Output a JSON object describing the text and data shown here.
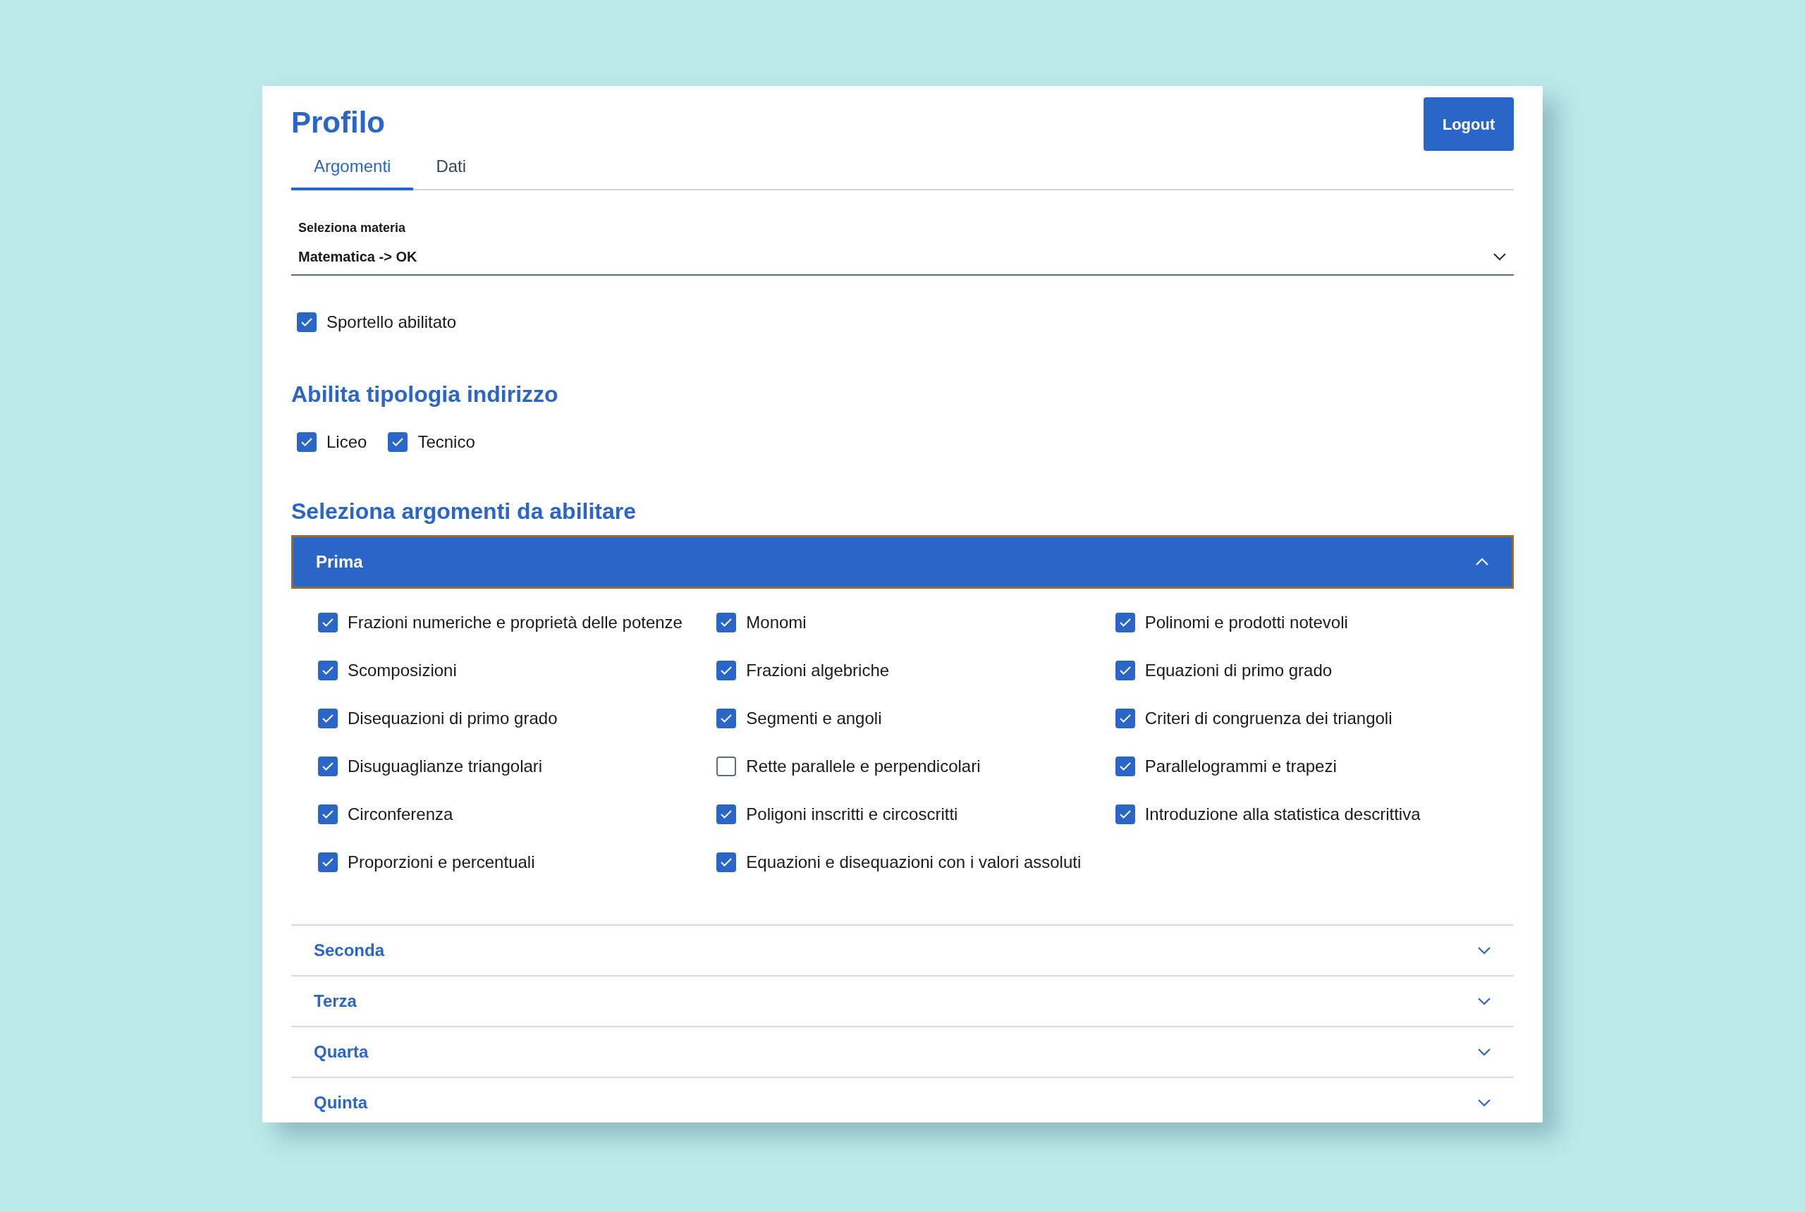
{
  "title": "Profilo",
  "logout": "Logout",
  "tabs": [
    {
      "label": "Argomenti",
      "selected": true
    },
    {
      "label": "Dati",
      "selected": false
    }
  ],
  "subject_select": {
    "label": "Seleziona materia",
    "value": "Matematica -> OK"
  },
  "desk_enabled": {
    "label": "Sportello abilitato",
    "checked": true
  },
  "school_types": {
    "heading": "Abilita tipologia indirizzo",
    "options": [
      {
        "label": "Liceo",
        "checked": true
      },
      {
        "label": "Tecnico",
        "checked": true
      }
    ]
  },
  "topics_heading": "Seleziona argomenti da abilitare",
  "sections": [
    {
      "title": "Prima",
      "expanded": true,
      "focused": true,
      "topics": [
        {
          "label": "Frazioni numeriche e proprietà delle potenze",
          "checked": true
        },
        {
          "label": "Monomi",
          "checked": true
        },
        {
          "label": "Polinomi e prodotti notevoli",
          "checked": true
        },
        {
          "label": "Scomposizioni",
          "checked": true
        },
        {
          "label": "Frazioni algebriche",
          "checked": true
        },
        {
          "label": "Equazioni di primo grado",
          "checked": true
        },
        {
          "label": "Disequazioni di primo grado",
          "checked": true
        },
        {
          "label": "Segmenti e angoli",
          "checked": true
        },
        {
          "label": "Criteri di congruenza dei triangoli",
          "checked": true
        },
        {
          "label": "Disuguaglianze triangolari",
          "checked": true
        },
        {
          "label": "Rette parallele e perpendicolari",
          "checked": false
        },
        {
          "label": "Parallelogrammi e trapezi",
          "checked": true
        },
        {
          "label": "Circonferenza",
          "checked": true
        },
        {
          "label": "Poligoni inscritti e circoscritti",
          "checked": true
        },
        {
          "label": "Introduzione alla statistica descrittiva",
          "checked": true
        },
        {
          "label": "Proporzioni e percentuali",
          "checked": true
        },
        {
          "label": "Equazioni e disequazioni con i valori assoluti",
          "checked": true
        }
      ]
    },
    {
      "title": "Seconda",
      "expanded": false,
      "focused": false
    },
    {
      "title": "Terza",
      "expanded": false,
      "focused": false
    },
    {
      "title": "Quarta",
      "expanded": false,
      "focused": false
    },
    {
      "title": "Quinta",
      "expanded": false,
      "focused": false
    }
  ]
}
